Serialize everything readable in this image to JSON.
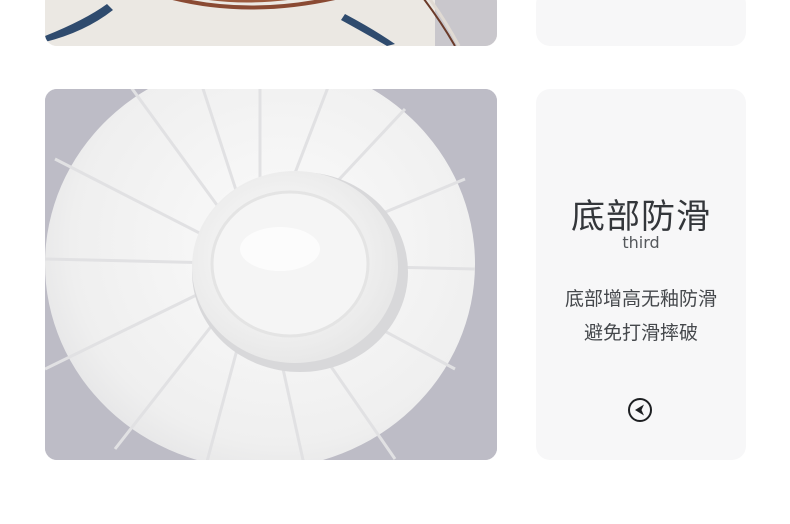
{
  "feature": {
    "title": "底部防滑",
    "subtitle": "third",
    "description_line1": "底部增高无釉防滑",
    "description_line2": "避免打滑摔破",
    "nav_icon": "left-arrow-circle-icon"
  },
  "colors": {
    "card_background": "#f7f7f8",
    "title": "#33363a",
    "photo_backdrop": "#bdbcc6",
    "porcelain": "#f3f3f2",
    "bowl_accent_blue": "#2f4b6e"
  }
}
